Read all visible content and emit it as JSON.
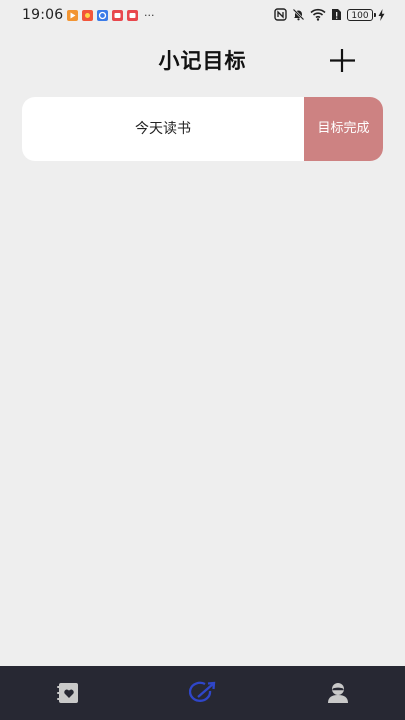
{
  "status_bar": {
    "time": "19:06",
    "notification_icons": [
      {
        "name": "play-app-icon",
        "color": "#f29533"
      },
      {
        "name": "game-app-icon",
        "color": "#f2553b"
      },
      {
        "name": "browser-app-icon",
        "color": "#3a7be8"
      },
      {
        "name": "red-app-icon-1",
        "color": "#e8474d"
      },
      {
        "name": "red-app-icon-2",
        "color": "#e8474d"
      }
    ],
    "more": "···",
    "battery": "100"
  },
  "header": {
    "title": "小记目标",
    "add_icon": "plus-icon"
  },
  "goals": [
    {
      "text": "今天读书",
      "action_label": "目标完成"
    }
  ],
  "bottom_nav": {
    "items": [
      {
        "name": "diary",
        "icon": "heart-notebook-icon",
        "active": false
      },
      {
        "name": "goals",
        "icon": "target-arrow-icon",
        "active": true
      },
      {
        "name": "profile",
        "icon": "user-icon",
        "active": false
      }
    ]
  },
  "colors": {
    "background": "#eeeeee",
    "card": "#ffffff",
    "complete_button": "#cd8282",
    "nav_bar": "#272833",
    "nav_active": "#2f46c9",
    "nav_inactive": "#c9c9c9"
  }
}
